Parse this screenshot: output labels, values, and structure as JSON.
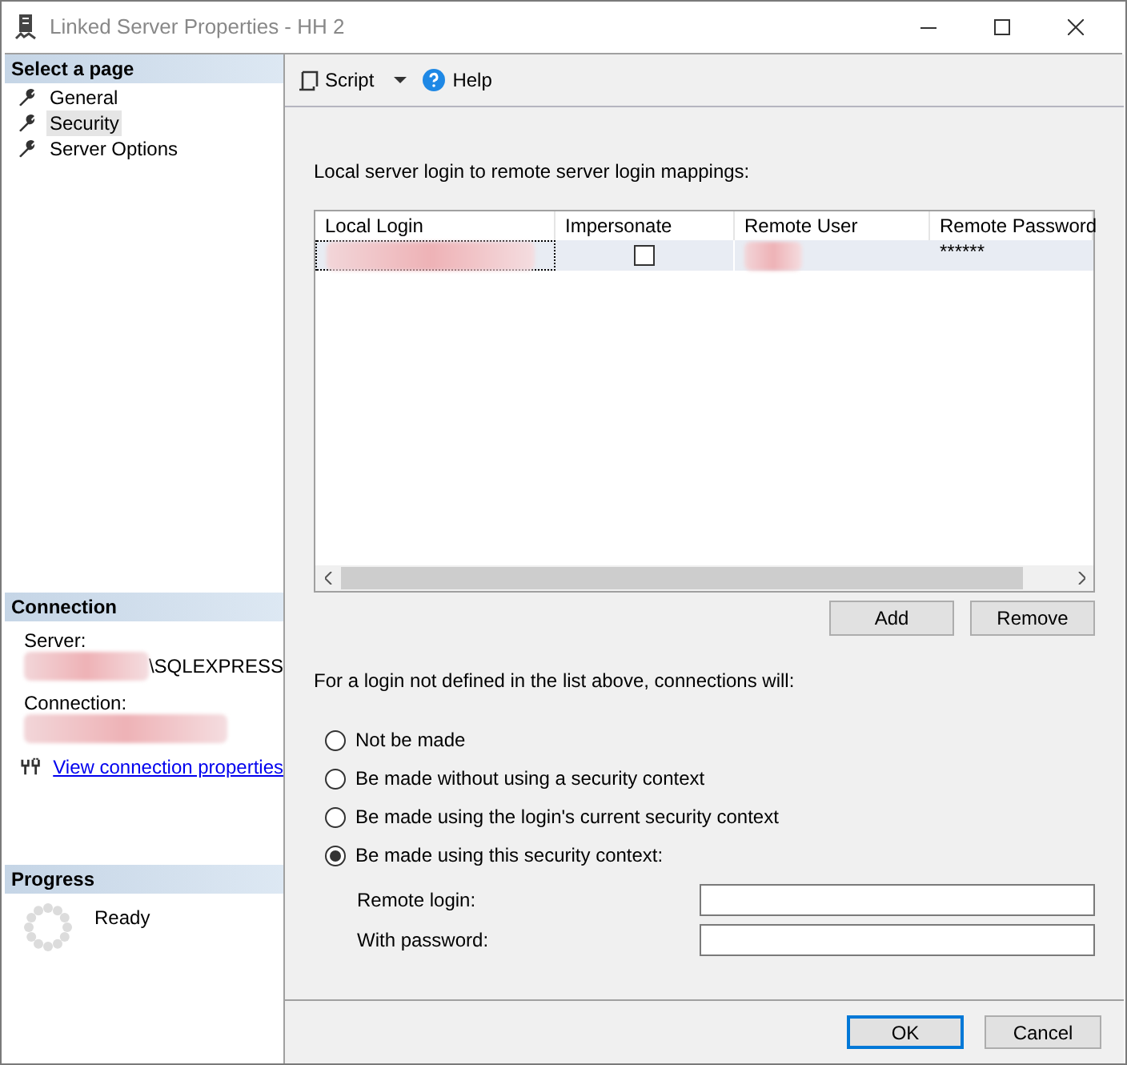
{
  "window": {
    "title": "Linked Server Properties - HH 2"
  },
  "sidebar": {
    "header": "Select a page",
    "items": [
      {
        "label": "General",
        "selected": false
      },
      {
        "label": "Security",
        "selected": true
      },
      {
        "label": "Server Options",
        "selected": false
      }
    ]
  },
  "connection": {
    "header": "Connection",
    "server_label": "Server:",
    "server_value": "\\SQLEXPRESS",
    "connection_label": "Connection:",
    "link": "View connection properties"
  },
  "progress": {
    "header": "Progress",
    "status": "Ready"
  },
  "toolbar": {
    "script": "Script",
    "help": "Help"
  },
  "mappings": {
    "label": "Local server login to remote server login mappings:",
    "columns": [
      "Local Login",
      "Impersonate",
      "Remote User",
      "Remote Password"
    ],
    "rows": [
      {
        "impersonate": false,
        "remote_password": "******",
        "selected": true
      }
    ]
  },
  "grid_buttons": [
    "Add",
    "Remove"
  ],
  "context": {
    "label": "For a login not defined in the list above, connections will:",
    "options": [
      {
        "label": "Not be made",
        "selected": false
      },
      {
        "label": "Be made without using a security context",
        "selected": false
      },
      {
        "label": "Be made using the login's current security context",
        "selected": false
      },
      {
        "label": "Be made using this security context:",
        "selected": true
      }
    ],
    "fields": [
      {
        "label": "Remote login:"
      },
      {
        "label": "With password:"
      }
    ]
  },
  "buttons": [
    {
      "label": "OK",
      "default": true
    },
    {
      "label": "Cancel",
      "default": false
    }
  ]
}
